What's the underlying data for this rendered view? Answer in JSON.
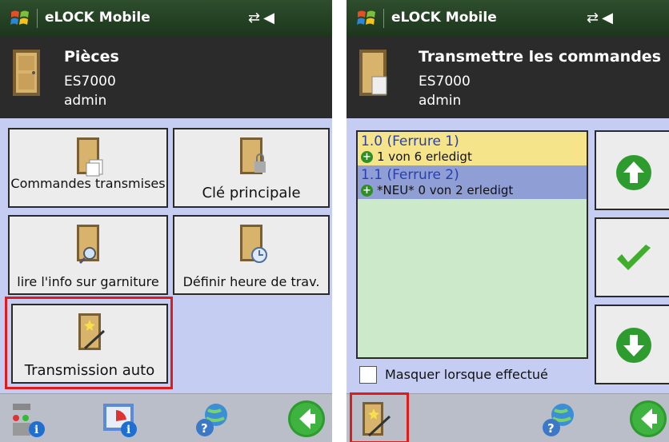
{
  "left": {
    "app_title": "eLOCK Mobile",
    "header": {
      "title": "Pièces",
      "device": "ES7000",
      "user": "admin"
    },
    "tiles": [
      {
        "label": "Commandes transmises"
      },
      {
        "label": "Clé principale"
      },
      {
        "label": "lire l'info sur garniture"
      },
      {
        "label": "Définir heure de trav."
      },
      {
        "label": "Transmission auto"
      }
    ]
  },
  "right": {
    "app_title": "eLOCK Mobile",
    "header": {
      "title": "Transmettre les commandes",
      "device": "ES7000",
      "user": "admin"
    },
    "list": [
      {
        "title": "1.0 (Ferrure 1)",
        "status": "1 von 6 erledigt",
        "color": "#f5e48a"
      },
      {
        "title": "1.1 (Ferrure 2)",
        "status": "*NEU*  0 von 2 erledigt",
        "color": "#8f9fd6"
      }
    ],
    "checkbox_label": "Masquer lorsque effectué"
  },
  "colors": {
    "titlebar": "#1c361c",
    "header": "#2b2b2b",
    "panel_bg": "#c5cdf2",
    "highlight": "#e01b1b",
    "list_bg": "#cce9c9"
  }
}
